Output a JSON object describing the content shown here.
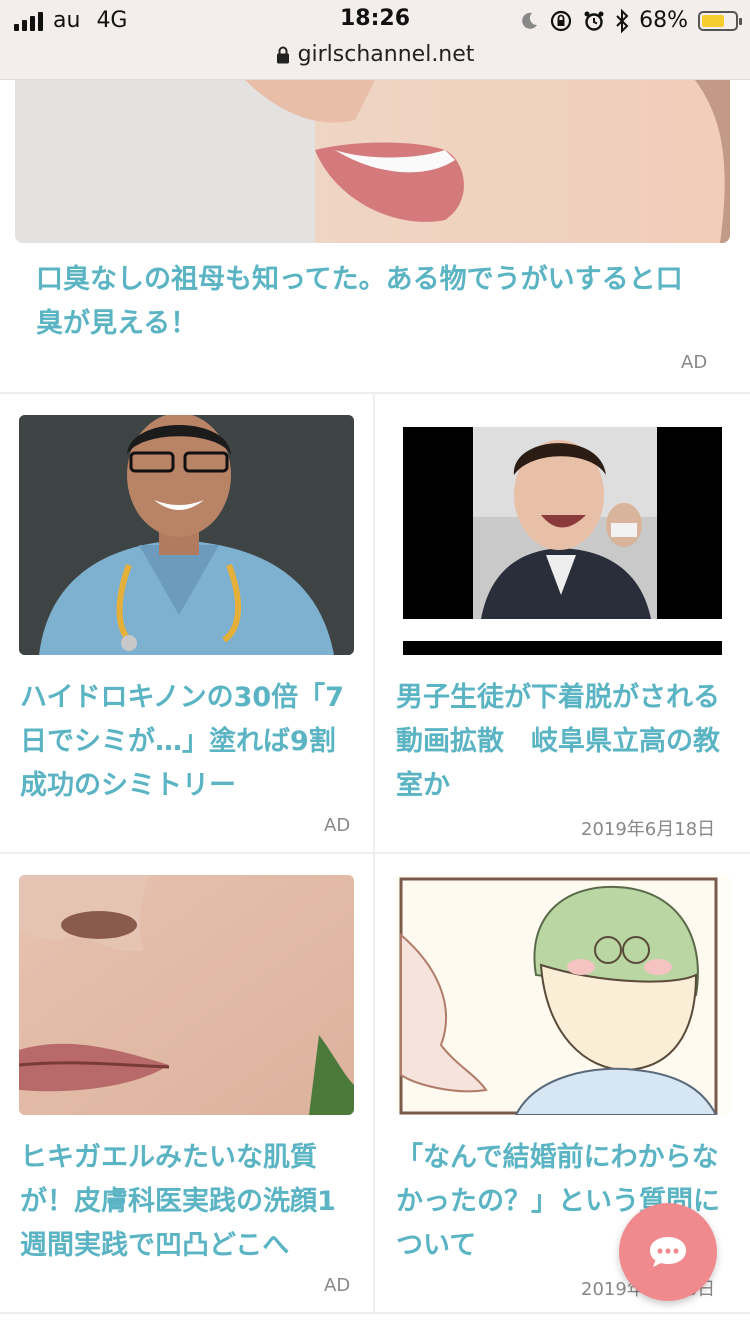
{
  "status_bar": {
    "carrier": "au",
    "network": "4G",
    "time": "18:26",
    "battery_percent": "68%",
    "battery_level": 0.68,
    "url": "girlschannel.net"
  },
  "colors": {
    "title": "#5bb4c3",
    "chat_button": "#f08a8f"
  },
  "top_article": {
    "title": "口臭なしの祖母も知ってた。ある物でうがいすると口臭が見える！",
    "badge": "AD"
  },
  "cards": [
    {
      "title": "ハイドロキノンの30倍「7日でシミが…」塗れば9割成功のシミトリー",
      "meta": "AD"
    },
    {
      "title": "男子生徒が下着脱がされる動画拡散　岐阜県立高の教室か",
      "meta": "2019年6月18日"
    },
    {
      "title": "ヒキガエルみたいな肌質が！皮膚科医実践の洗顔1週間実践で凹凸どこへ",
      "meta": "AD"
    },
    {
      "title": "「なんで結婚前にわからなかったの？」という質問について",
      "meta": "2019年6月18日"
    }
  ],
  "icons": [
    "signal-icon",
    "moon-icon",
    "rotation-lock-icon",
    "alarm-icon",
    "bluetooth-icon",
    "battery-icon",
    "lock-icon",
    "chat-icon"
  ]
}
